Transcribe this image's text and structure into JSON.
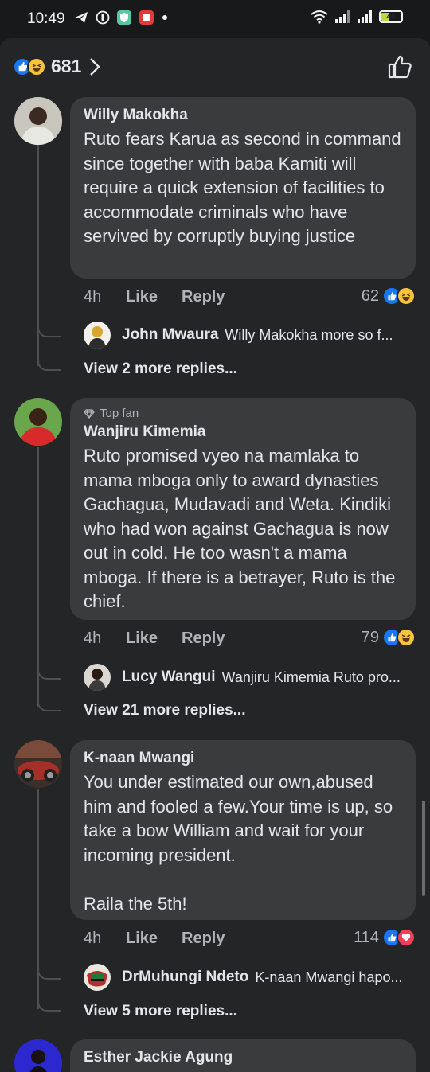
{
  "status_bar": {
    "time": "10:49",
    "battery": "40",
    "icons": [
      "telegram-icon",
      "cast-icon",
      "vpn-shield-icon",
      "calendar-badge-icon",
      "dot-icon",
      "wifi-icon",
      "signal-icon",
      "signal-icon",
      "battery-icon"
    ]
  },
  "reactions_header": {
    "reaction_types": [
      "like",
      "haha"
    ],
    "count": "681"
  },
  "comments": [
    {
      "top_fan": "",
      "author": "Willy Makokha",
      "text": "Ruto fears Karua as second in command since together with baba Kamiti will require a quick extension of facilities to accommodate criminals who have servived by corruptly buying justice",
      "age": "4h",
      "like_label": "Like",
      "reply_label": "Reply",
      "reaction_count": "62",
      "reaction_types": [
        "like",
        "haha"
      ],
      "reply_preview": {
        "name": "John Mwaura",
        "text": "Willy Makokha more so f..."
      },
      "more_replies": "View 2 more replies..."
    },
    {
      "top_fan": "Top fan",
      "author": "Wanjiru Kimemia",
      "text": "Ruto promised vyeo na mamlaka to mama mboga only to award dynasties Gachagua, Mudavadi and Weta. Kindiki who had won against Gachagua is now out in cold. He too wasn't a mama mboga. If there is a betrayer, Ruto is the chief.",
      "age": "4h",
      "like_label": "Like",
      "reply_label": "Reply",
      "reaction_count": "79",
      "reaction_types": [
        "like",
        "haha"
      ],
      "reply_preview": {
        "name": "Lucy Wangui",
        "text": "Wanjiru Kimemia Ruto pro..."
      },
      "more_replies": "View 21 more replies..."
    },
    {
      "top_fan": "",
      "author": "K-naan Mwangi",
      "text": "You under estimated our own,abused him and fooled a few.Your time is up, so take a bow William and wait for your incoming president.\n\nRaila the 5th!",
      "age": "4h",
      "like_label": "Like",
      "reply_label": "Reply",
      "reaction_count": "114",
      "reaction_types": [
        "like",
        "love"
      ],
      "reply_preview": {
        "name": "DrMuhungi Ndeto",
        "text": "K-naan Mwangi hapo..."
      },
      "more_replies": "View 5 more replies..."
    },
    {
      "author": "Esther Jackie Agung"
    }
  ]
}
